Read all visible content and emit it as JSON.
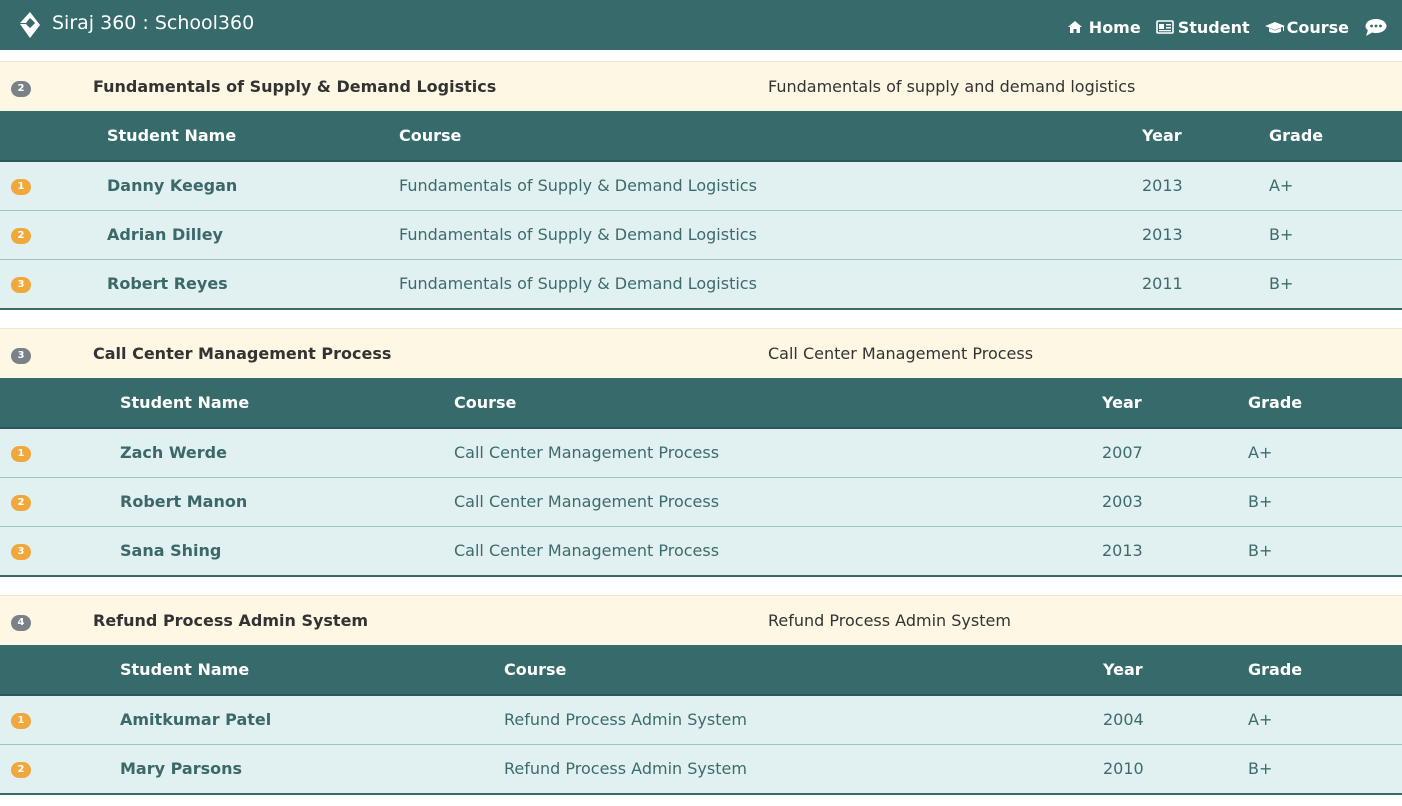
{
  "header": {
    "brand": "Siraj 360 : School360",
    "nav": [
      {
        "label": "Home",
        "icon": "home-icon"
      },
      {
        "label": "Student",
        "icon": "id-card-icon"
      },
      {
        "label": "Course",
        "icon": "graduation-cap-icon"
      }
    ],
    "chat_icon": "chat-icon"
  },
  "columns": [
    "Student Name",
    "Course",
    "Year",
    "Grade"
  ],
  "groups": [
    {
      "badge": "2",
      "title": "Fundamentals of Supply & Demand Logistics",
      "description": "Fundamentals of supply and demand logistics",
      "rows": [
        {
          "index": "1",
          "name": "Danny Keegan",
          "course": "Fundamentals of Supply & Demand Logistics",
          "year": "2013",
          "grade": "A+"
        },
        {
          "index": "2",
          "name": "Adrian Dilley",
          "course": "Fundamentals of Supply & Demand Logistics",
          "year": "2013",
          "grade": "B+"
        },
        {
          "index": "3",
          "name": "Robert Reyes",
          "course": "Fundamentals of Supply & Demand Logistics",
          "year": "2011",
          "grade": "B+"
        }
      ]
    },
    {
      "badge": "3",
      "title": "Call Center Management Process",
      "description": "Call Center Management Process",
      "rows": [
        {
          "index": "1",
          "name": "Zach Werde",
          "course": "Call Center Management Process",
          "year": "2007",
          "grade": "A+"
        },
        {
          "index": "2",
          "name": "Robert Manon",
          "course": "Call Center Management Process",
          "year": "2003",
          "grade": "B+"
        },
        {
          "index": "3",
          "name": "Sana Shing",
          "course": "Call Center Management Process",
          "year": "2013",
          "grade": "B+"
        }
      ]
    },
    {
      "badge": "4",
      "title": "Refund Process Admin System",
      "description": "Refund Process Admin System",
      "rows": [
        {
          "index": "1",
          "name": "Amitkumar Patel",
          "course": "Refund Process Admin System",
          "year": "2004",
          "grade": "A+"
        },
        {
          "index": "2",
          "name": "Mary Parsons",
          "course": "Refund Process Admin System",
          "year": "2010",
          "grade": "B+"
        }
      ]
    }
  ],
  "colors": {
    "navbar": "#376b6b",
    "group_header": "#fdf7e3",
    "row_bg": "#e1f0f0",
    "badge_gray": "#7a8288",
    "badge_orange": "#f0a73b"
  }
}
